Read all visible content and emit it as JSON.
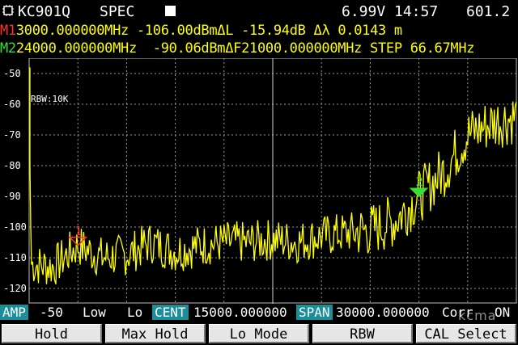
{
  "status": {
    "device_name": "KC901Q",
    "mode": "SPEC",
    "voltage": "6.99V",
    "time": "14:57",
    "counter": "601.2"
  },
  "markers": {
    "m1": {
      "tag": "M1",
      "freq": "3000.000000",
      "freq_unit": "MHz",
      "level": "-106.00",
      "level_unit": "dBm",
      "delta_l_label": "ΔL",
      "delta_l": "-15.94dB",
      "delta_lambda_label": "Δλ",
      "delta_lambda": "0.0143 m"
    },
    "m2": {
      "tag": "M2",
      "freq": "24000.000000",
      "freq_unit": "MHz",
      "level": "-90.06",
      "level_unit": "dBm",
      "delta_f_label": "ΔF",
      "delta_f": "21000.000000MHz",
      "step_label": "STEP",
      "step": "66.67MHz"
    }
  },
  "plot": {
    "rbw_label": "RBW:10K",
    "marker1_label": "1",
    "marker2_label": "2",
    "trace_color": "#ffff00",
    "marker1_color": "#ff3030",
    "marker2_color": "#38e038"
  },
  "chart_data": {
    "type": "line",
    "ylim": [
      -125,
      -45
    ],
    "y_ticks": [
      "-50",
      "-60",
      "-70",
      "-80",
      "-90",
      "-100",
      "-110",
      "-120"
    ],
    "x_range_mhz": [
      0,
      30000
    ],
    "series": [
      {
        "x": [
          0,
          1500,
          3000,
          4500,
          6000,
          7500,
          9000,
          10500,
          12000,
          13500,
          15000,
          16500,
          18000,
          19500,
          21000,
          22500,
          24000,
          25500,
          27000,
          28500,
          30000
        ],
        "values": [
          -112,
          -113,
          -106,
          -110,
          -109,
          -105,
          -108,
          -106,
          -105,
          -105,
          -104,
          -105,
          -103,
          -102,
          -101,
          -98,
          -90,
          -82,
          -70,
          -66,
          -64
        ]
      }
    ],
    "markers": [
      {
        "label": "1",
        "x": 3000,
        "y": -106
      },
      {
        "label": "2",
        "x": 24000,
        "y": -90.06
      }
    ]
  },
  "settings": {
    "amp_label": "AMP",
    "amp_value": "-50",
    "low_label": "Low",
    "lo_label": "Lo",
    "cent_label": "CENT",
    "cent_value": "15000.000000",
    "span_label": "SPAN",
    "span_value": "30000.000000",
    "corr_label": "Corr",
    "corr_value": "ON"
  },
  "softkeys": [
    "Hold",
    "Max Hold",
    "Lo Mode",
    "RBW",
    "CAL Select"
  ],
  "watermark": "kcma"
}
